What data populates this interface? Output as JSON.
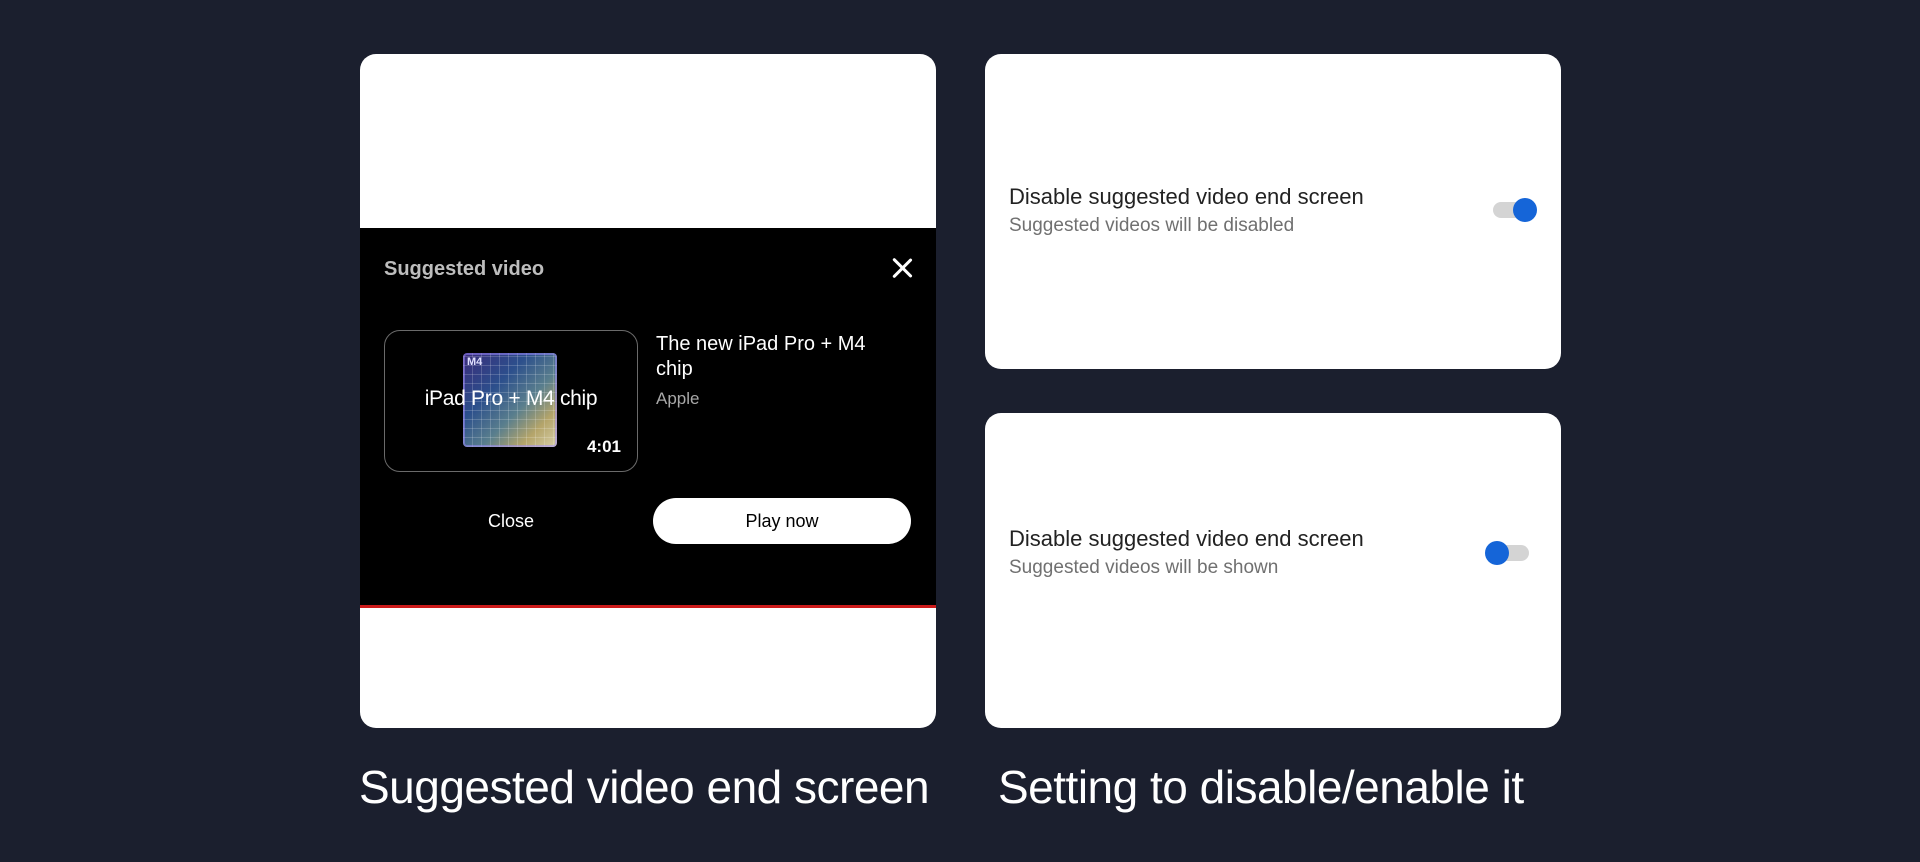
{
  "end_screen": {
    "heading": "Suggested video",
    "video": {
      "thumbnail_text": "iPad Pro + M4 chip",
      "chip_label": " M4",
      "duration": "4:01",
      "title": "The new iPad Pro + M4 chip",
      "channel": "Apple"
    },
    "close_label": "Close",
    "play_label": "Play now",
    "close_icon": "close-icon",
    "colors": {
      "progress": "#cc1a1a"
    }
  },
  "settings": [
    {
      "title": "Disable suggested video end screen",
      "subtitle": "Suggested videos will be disabled",
      "state": "on"
    },
    {
      "title": "Disable suggested video end screen",
      "subtitle": "Suggested videos will be shown",
      "state": "off"
    }
  ],
  "captions": {
    "left": "Suggested video end screen",
    "right": "Setting  to disable/enable it"
  },
  "colors": {
    "background": "#1b1f2e",
    "toggle_accent": "#1565d8"
  }
}
